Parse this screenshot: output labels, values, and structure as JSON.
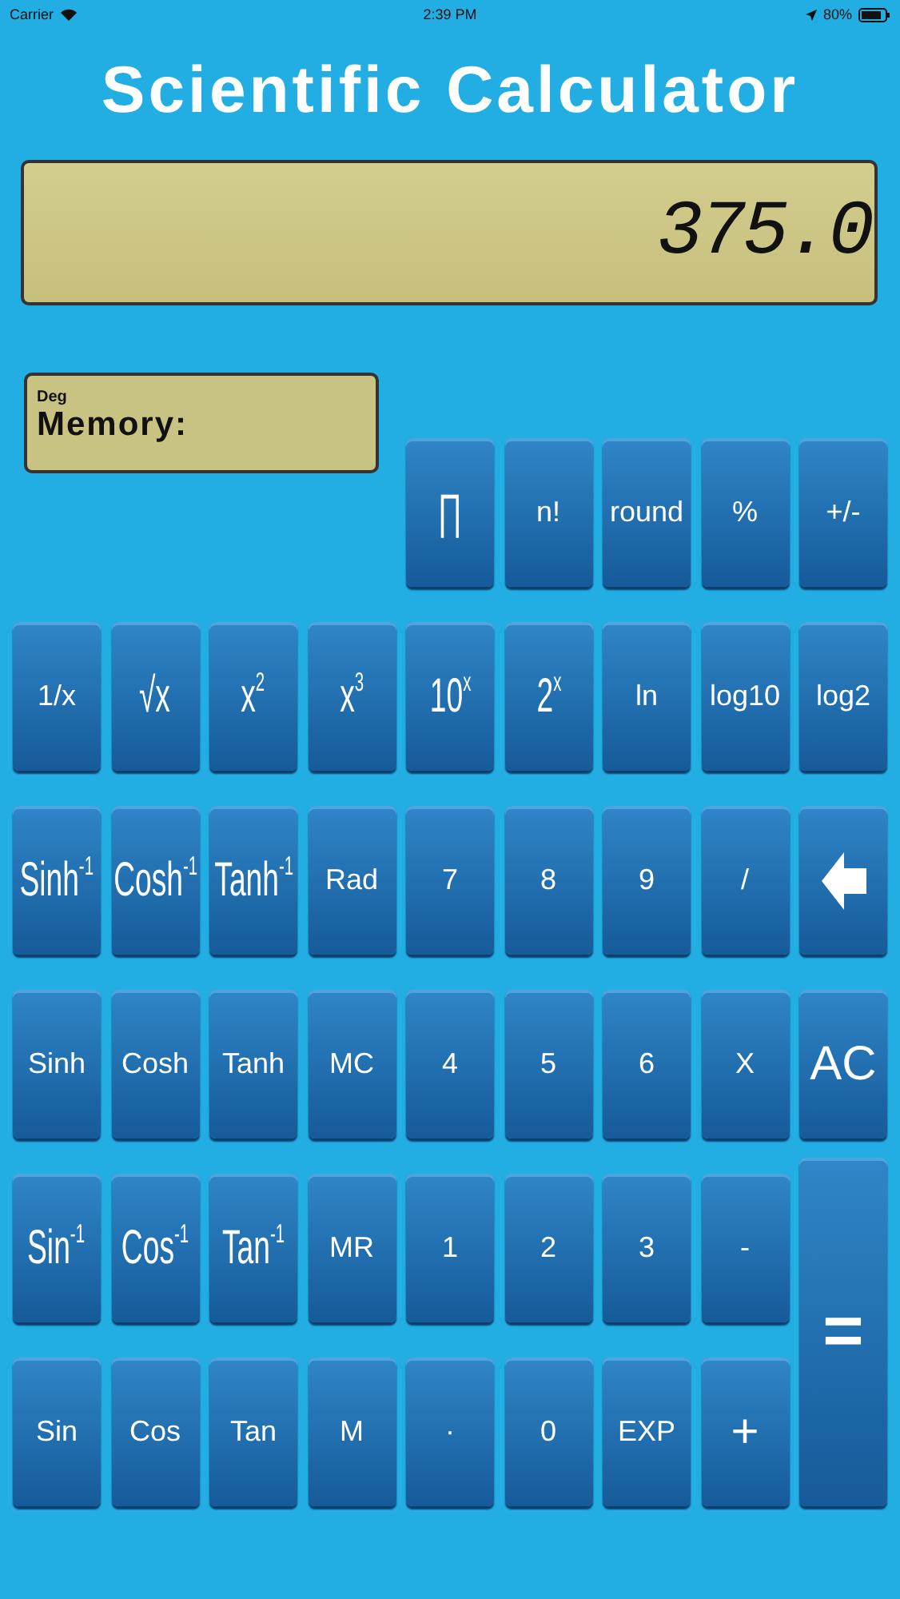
{
  "status_bar": {
    "carrier": "Carrier",
    "time": "2:39 PM",
    "battery": "80%"
  },
  "title": "Scientific Calculator",
  "display": {
    "value": "375.0"
  },
  "memory_panel": {
    "mode": "Deg",
    "label": "Memory:"
  },
  "keypad": [
    [
      {
        "kind": "big",
        "label": "∏"
      },
      {
        "kind": "key",
        "label": "n!"
      },
      {
        "kind": "key",
        "label": "round"
      },
      {
        "kind": "key",
        "label": "%"
      },
      {
        "kind": "key",
        "label": "+/-"
      }
    ],
    [
      {
        "kind": "key",
        "label": "1/x"
      },
      {
        "kind": "big",
        "label": "√x"
      },
      {
        "kind": "big",
        "label": "x$^{2}$"
      },
      {
        "kind": "big",
        "label": "x$^{3}$"
      },
      {
        "kind": "big",
        "label": "10$^{x}$"
      },
      {
        "kind": "big",
        "label": "2$^{x}$"
      },
      {
        "kind": "key",
        "label": "ln"
      },
      {
        "kind": "key",
        "label": "log10"
      },
      {
        "kind": "key",
        "label": "log2"
      }
    ],
    [
      {
        "kind": "big",
        "label": "Sinh$^{-1}$"
      },
      {
        "kind": "big",
        "label": "Cosh$^{-1}$"
      },
      {
        "kind": "big",
        "label": "Tanh$^{-1}$"
      },
      {
        "kind": "key",
        "label": "Rad"
      },
      {
        "kind": "key",
        "label": "7"
      },
      {
        "kind": "key",
        "label": "8"
      },
      {
        "kind": "key",
        "label": "9"
      },
      {
        "kind": "key",
        "label": "/"
      },
      {
        "kind": "backspace"
      }
    ],
    [
      {
        "kind": "key",
        "label": "Sinh"
      },
      {
        "kind": "key",
        "label": "Cosh"
      },
      {
        "kind": "key",
        "label": "Tanh"
      },
      {
        "kind": "key",
        "label": "MC"
      },
      {
        "kind": "key",
        "label": "4"
      },
      {
        "kind": "key",
        "label": "5"
      },
      {
        "kind": "key",
        "label": "6"
      },
      {
        "kind": "key",
        "label": "X"
      },
      {
        "kind": "large",
        "label": "AC"
      }
    ],
    [
      {
        "kind": "big",
        "label": "Sin$^{-1}$"
      },
      {
        "kind": "big",
        "label": "Cos$^{-1}$"
      },
      {
        "kind": "big",
        "label": "Tan$^{-1}$"
      },
      {
        "kind": "key",
        "label": "MR"
      },
      {
        "kind": "key",
        "label": "1"
      },
      {
        "kind": "key",
        "label": "2"
      },
      {
        "kind": "key",
        "label": "3"
      },
      {
        "kind": "key",
        "label": "-"
      },
      {
        "kind": "tall",
        "label": "="
      }
    ],
    [
      {
        "kind": "key",
        "label": "Sin"
      },
      {
        "kind": "key",
        "label": "Cos"
      },
      {
        "kind": "key",
        "label": "Tan"
      },
      {
        "kind": "key",
        "label": "M"
      },
      {
        "kind": "key",
        "label": "·"
      },
      {
        "kind": "key",
        "label": "0"
      },
      {
        "kind": "key",
        "label": "EXP"
      },
      {
        "kind": "large",
        "label": "+"
      }
    ]
  ]
}
